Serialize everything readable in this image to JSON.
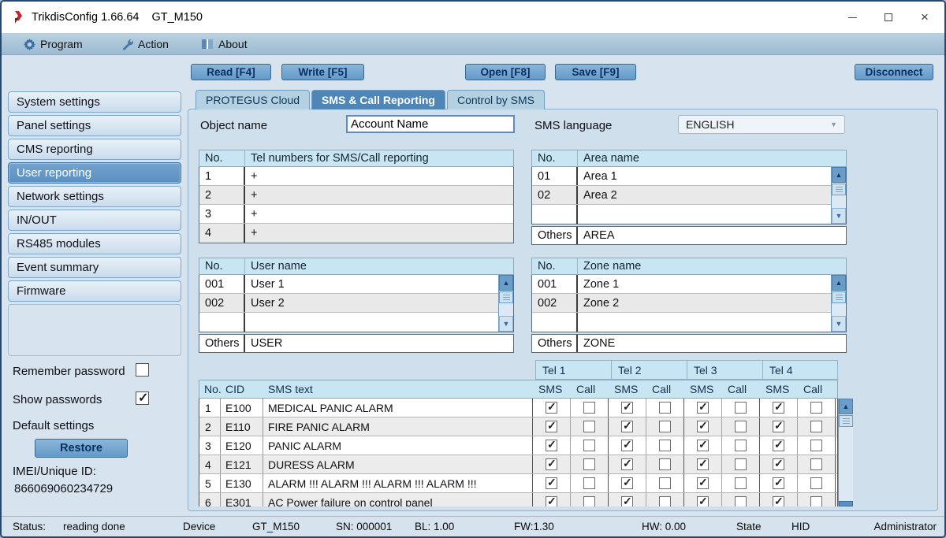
{
  "window": {
    "title": "TrikdisConfig 1.66.64",
    "device": "GT_M150"
  },
  "menu": {
    "items": [
      {
        "label": "Program",
        "icon": "gear-icon"
      },
      {
        "label": "Action",
        "icon": "wrench-icon"
      },
      {
        "label": "About",
        "icon": "book-icon"
      }
    ]
  },
  "toolbar": {
    "read_label": "Read [F4]",
    "write_label": "Write [F5]",
    "open_label": "Open [F8]",
    "save_label": "Save [F9]",
    "disconnect_label": "Disconnect"
  },
  "sidebar": {
    "items": [
      {
        "label": "System settings",
        "selected": false
      },
      {
        "label": "Panel settings",
        "selected": false
      },
      {
        "label": "CMS reporting",
        "selected": false
      },
      {
        "label": "User reporting",
        "selected": true
      },
      {
        "label": "Network settings",
        "selected": false
      },
      {
        "label": "IN/OUT",
        "selected": false
      },
      {
        "label": "RS485 modules",
        "selected": false
      },
      {
        "label": "Event summary",
        "selected": false
      },
      {
        "label": "Firmware",
        "selected": false
      }
    ]
  },
  "options": {
    "remember_password": {
      "label": "Remember password",
      "checked": false
    },
    "show_passwords": {
      "label": "Show passwords",
      "checked": true
    },
    "default_settings_label": "Default settings",
    "restore_label": "Restore",
    "imei_label": "IMEI/Unique ID:",
    "imei_value": "866069060234729"
  },
  "tabs": {
    "items": [
      {
        "label": "PROTEGUS Cloud",
        "active": false
      },
      {
        "label": "SMS & Call Reporting",
        "active": true
      },
      {
        "label": "Control by SMS",
        "active": false
      }
    ]
  },
  "form": {
    "object_name": {
      "label": "Object name",
      "value": "Account Name"
    },
    "sms_language": {
      "label": "SMS language",
      "value": "ENGLISH"
    }
  },
  "tables": {
    "tel": {
      "headers": [
        "No.",
        "Tel numbers for SMS/Call reporting"
      ],
      "rows": [
        [
          "1",
          "+"
        ],
        [
          "2",
          "+"
        ],
        [
          "3",
          "+"
        ],
        [
          "4",
          "+"
        ]
      ]
    },
    "area": {
      "headers": [
        "No.",
        "Area name"
      ],
      "rows": [
        [
          "01",
          "Area 1"
        ],
        [
          "02",
          "Area 2"
        ],
        [
          "",
          ""
        ]
      ],
      "others": {
        "label": "Others",
        "value": "AREA"
      }
    },
    "user": {
      "headers": [
        "No.",
        "User name"
      ],
      "rows": [
        [
          "001",
          "User 1"
        ],
        [
          "002",
          "User 2"
        ],
        [
          "",
          ""
        ]
      ],
      "others": {
        "label": "Others",
        "value": "USER"
      }
    },
    "zone": {
      "headers": [
        "No.",
        "Zone name"
      ],
      "rows": [
        [
          "001",
          "Zone 1"
        ],
        [
          "002",
          "Zone 2"
        ],
        [
          "",
          ""
        ]
      ],
      "others": {
        "label": "Others",
        "value": "ZONE"
      }
    }
  },
  "events": {
    "tel_groups": [
      "Tel 1",
      "Tel 2",
      "Tel 3",
      "Tel 4"
    ],
    "col_headers": [
      "No.",
      "CID",
      "SMS text"
    ],
    "pair_headers": [
      "SMS",
      "Call"
    ],
    "rows": [
      {
        "no": "1",
        "cid": "E100",
        "text": "MEDICAL PANIC ALARM",
        "checks": [
          1,
          0,
          1,
          0,
          1,
          0,
          1,
          0
        ]
      },
      {
        "no": "2",
        "cid": "E110",
        "text": "FIRE PANIC ALARM",
        "checks": [
          1,
          0,
          1,
          0,
          1,
          0,
          1,
          0
        ]
      },
      {
        "no": "3",
        "cid": "E120",
        "text": "PANIC ALARM",
        "checks": [
          1,
          0,
          1,
          0,
          1,
          0,
          1,
          0
        ]
      },
      {
        "no": "4",
        "cid": "E121",
        "text": "DURESS ALARM",
        "checks": [
          1,
          0,
          1,
          0,
          1,
          0,
          1,
          0
        ]
      },
      {
        "no": "5",
        "cid": "E130",
        "text": "ALARM !!! ALARM !!! ALARM !!! ALARM !!!",
        "checks": [
          1,
          0,
          1,
          0,
          1,
          0,
          1,
          0
        ]
      },
      {
        "no": "6",
        "cid": "E301",
        "text": "AC Power failure on control panel",
        "checks": [
          1,
          0,
          1,
          0,
          1,
          0,
          1,
          0
        ]
      }
    ]
  },
  "status_bar": {
    "items": [
      "Status:",
      "reading done",
      "Device",
      "GT_M150",
      "SN: 000001",
      "BL: 1.00",
      "FW:1.30",
      "HW: 0.00",
      "State",
      "HID",
      "Administrator"
    ]
  },
  "colors": {
    "accent": "#4e86b8",
    "selected_item": "#6296c5",
    "table_header": "#c7e5f3",
    "logo_red": "#c1272d"
  }
}
